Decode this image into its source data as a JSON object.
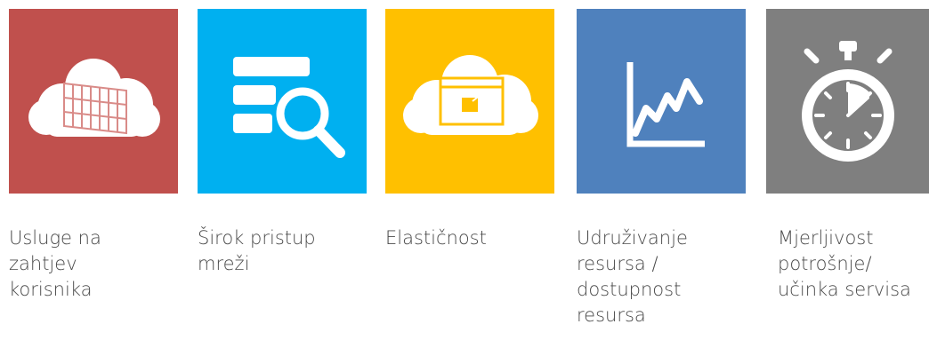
{
  "tiles": [
    {
      "label": "Usluge na\nzahtjev\nkorisnika",
      "color": "#c0504d",
      "icon": "cloud-datacenter-icon"
    },
    {
      "label": "Širok pristup\nmreži",
      "color": "#00b0f0",
      "icon": "search-database-icon"
    },
    {
      "label": "Elastičnost",
      "color": "#ffc000",
      "icon": "cloud-window-icon"
    },
    {
      "label": "Udruživanje\nresursa /\ndostupnost\nresursa",
      "color": "#4f81bd",
      "icon": "line-chart-icon"
    },
    {
      "label": "Mjerljivost\npotrošnje/\nučinka servisa",
      "color": "#7f7f7f",
      "icon": "stopwatch-icon"
    }
  ]
}
